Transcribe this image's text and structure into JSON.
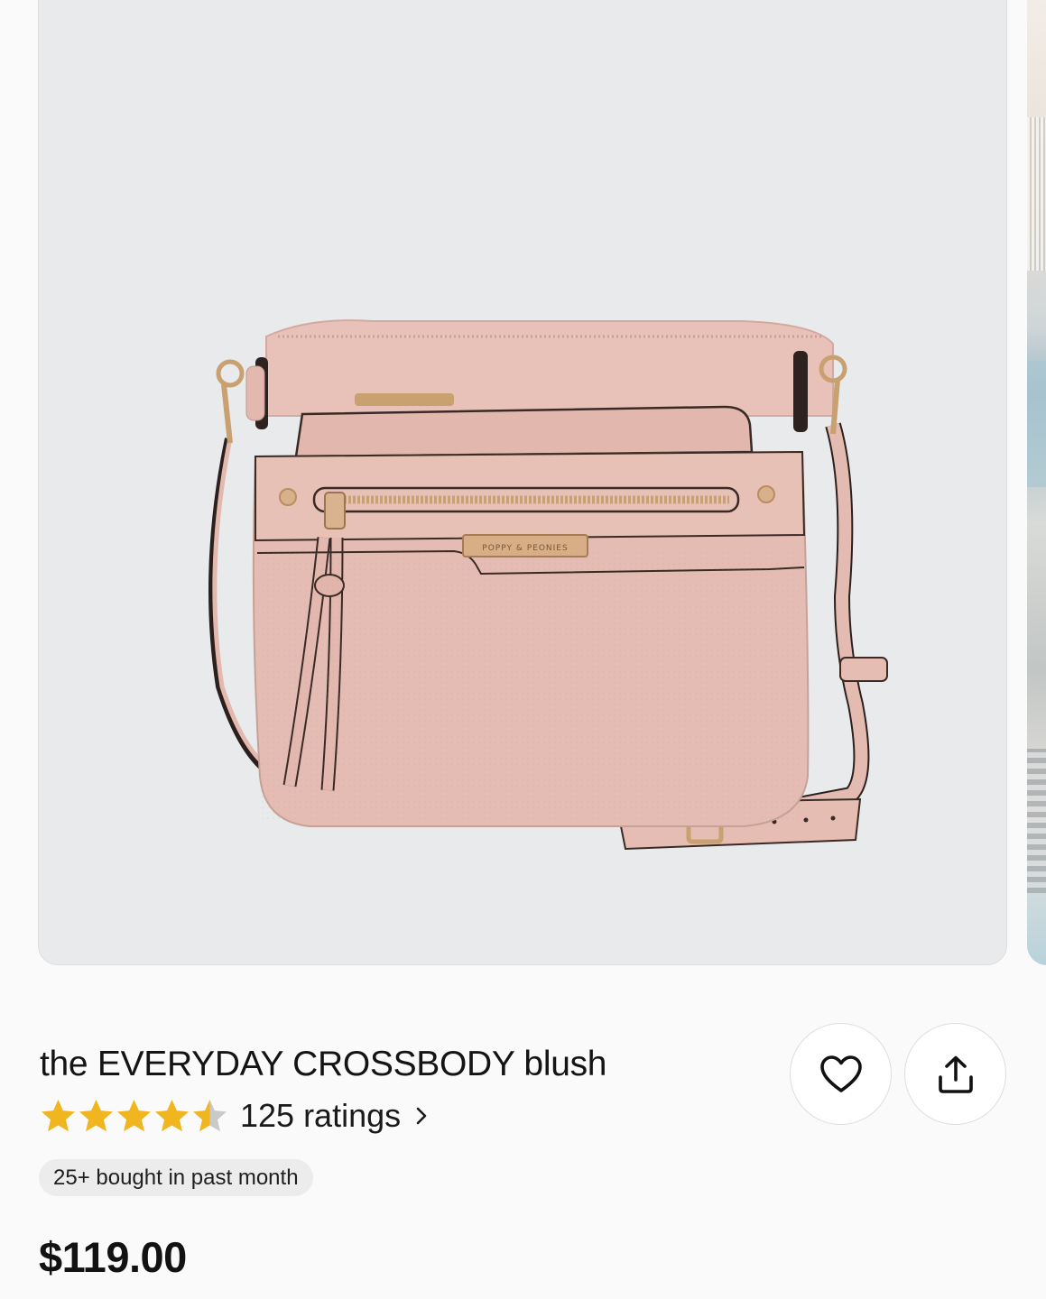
{
  "product": {
    "title": "the EVERYDAY CROSSBODY blush",
    "rating_value": 4.5,
    "rating_max": 5,
    "ratings_label": "125 ratings",
    "badge": "25+ bought in past month",
    "price": "$119.00",
    "image_subject": "blush pink crossbody bag with gold hardware",
    "brand_plate_text": "POPPY & PEONIES"
  },
  "icons": {
    "favorite": "heart-outline-icon",
    "share": "share-upload-icon",
    "ratings_chevron": "chevron-right-icon"
  },
  "colors": {
    "star_fill": "#f1b61f",
    "star_empty": "#c9c9c9",
    "bag": "#e5bcb3",
    "hardware": "#c9a070"
  }
}
